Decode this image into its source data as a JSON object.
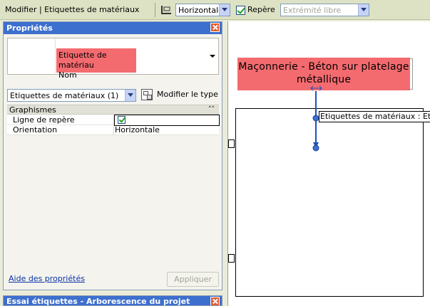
{
  "options_bar": {
    "title": "Modifier | Etiquettes de matériaux",
    "orientation_value": "Horizontale",
    "leader_label": "Repère",
    "leader_checked": true,
    "leader_end_value": "Extrémité libre"
  },
  "properties": {
    "title": "Propriétés",
    "type_name_line1": "Etiquette de matériau",
    "type_name_line2": "Nom",
    "instance_filter": "Etiquettes de matériaux (1)",
    "edit_type_label": "Modifier le type",
    "group_label": "Graphismes",
    "rows": [
      {
        "key": "Ligne de repère",
        "value": "",
        "checked": true
      },
      {
        "key": "Orientation",
        "value": "Horizontale"
      }
    ],
    "help_link": "Aide des propriétés",
    "apply_label": "Appliquer"
  },
  "project_browser": {
    "title": "Essai étiquettes - Arborescence du projet"
  },
  "canvas": {
    "tag_line1": "Maçonnerie - Béton sur platelage",
    "tag_line2": "métallique",
    "tooltip": "Etiquettes de matériaux : Etiquette de matériau : Nom"
  },
  "colors": {
    "highlight": "#f46b6f",
    "panel_title": "#3d6fce",
    "leader": "#1f4fbf"
  }
}
